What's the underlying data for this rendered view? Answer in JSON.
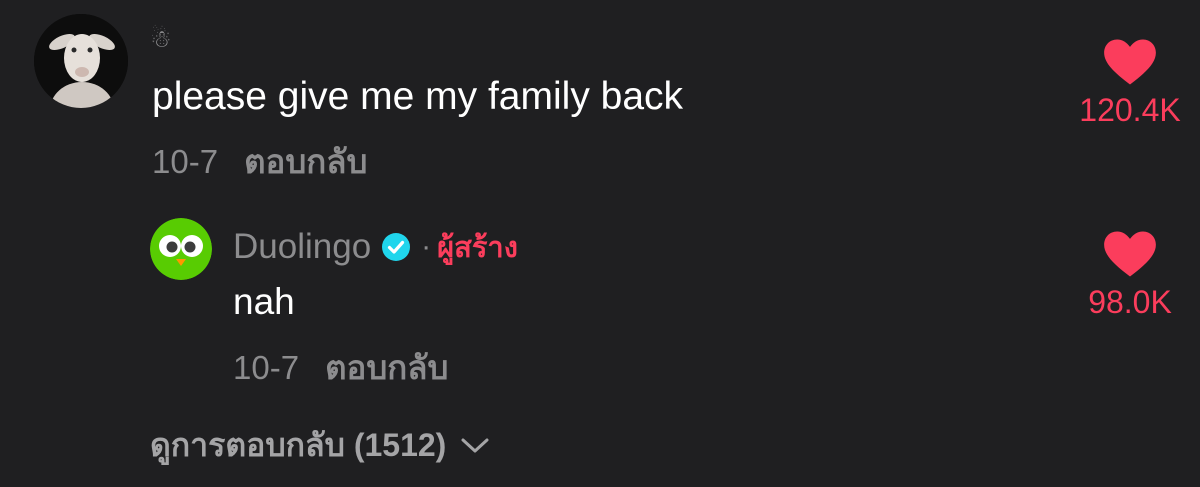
{
  "comment": {
    "username": "☃",
    "text": "please give me my family back",
    "date": "10-7",
    "reply_label": "ตอบกลับ",
    "likes": "120.4K"
  },
  "reply": {
    "username": "Duolingo",
    "separator": "·",
    "creator_badge": "ผู้สร้าง",
    "text": "nah",
    "date": "10-7",
    "reply_label": "ตอบกลับ",
    "likes": "98.0K"
  },
  "view_replies": {
    "label": "ดูการตอบกลับ (1512)"
  },
  "colors": {
    "background": "#1f1f21",
    "like_red": "#fb3d5c",
    "muted_text": "#8c8c8e",
    "verified_blue": "#20d5ec",
    "duolingo_green": "#58cc02"
  },
  "icons": {
    "like": "heart-icon",
    "verified": "verified-check-icon",
    "expand": "chevron-down-icon"
  }
}
